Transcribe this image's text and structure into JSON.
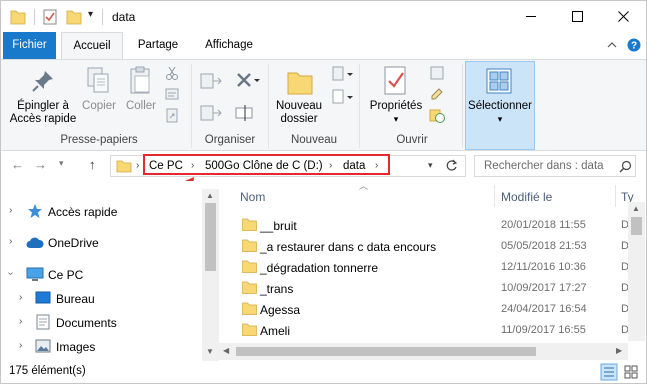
{
  "window": {
    "title": "data",
    "controls": {
      "minimize": "minimize-icon",
      "maximize": "maximize-icon",
      "close": "close-icon"
    }
  },
  "ribbon_tabs": [
    "Fichier",
    "Accueil",
    "Partage",
    "Affichage"
  ],
  "ribbon": {
    "pin_label_1": "Épingler à",
    "pin_label_2": "Accès rapide",
    "copy_label": "Copier",
    "paste_label": "Coller",
    "group_clipboard": "Presse-papiers",
    "group_organize": "Organiser",
    "new_folder_1": "Nouveau",
    "new_folder_2": "dossier",
    "group_new": "Nouveau",
    "properties_label": "Propriétés",
    "group_open": "Ouvrir",
    "select_label": "Sélectionner"
  },
  "address": {
    "crumbs": [
      "Ce PC",
      "500Go Clône de C (D:)",
      "data"
    ],
    "search_placeholder": "Rechercher dans : data"
  },
  "nav_pane": {
    "items": [
      {
        "label": "Accès rapide",
        "icon": "star-icon"
      },
      {
        "label": "OneDrive",
        "icon": "cloud-icon"
      },
      {
        "label": "Ce PC",
        "icon": "computer-icon"
      },
      {
        "label": "Bureau",
        "icon": "desktop-icon"
      },
      {
        "label": "Documents",
        "icon": "document-icon"
      },
      {
        "label": "Images",
        "icon": "image-icon"
      }
    ]
  },
  "file_list": {
    "columns": [
      "Nom",
      "Modifié le",
      "Ty"
    ],
    "rows": [
      {
        "name": "__bruit",
        "date": "20/01/2018 11:55",
        "type": "D"
      },
      {
        "name": "_a restaurer dans c data encours",
        "date": "05/05/2018 21:53",
        "type": "D"
      },
      {
        "name": "_dégradation tonnerre",
        "date": "12/11/2016 10:36",
        "type": "D"
      },
      {
        "name": "_trans",
        "date": "10/09/2017 17:27",
        "type": "D"
      },
      {
        "name": "Agessa",
        "date": "24/04/2017 16:54",
        "type": "D"
      },
      {
        "name": "Ameli",
        "date": "11/09/2017 16:55",
        "type": "D"
      }
    ]
  },
  "status": {
    "count": "175 élément(s)"
  },
  "colors": {
    "accent": "#1979ca",
    "highlight": "#e3292d",
    "folder": "#f8d775"
  }
}
